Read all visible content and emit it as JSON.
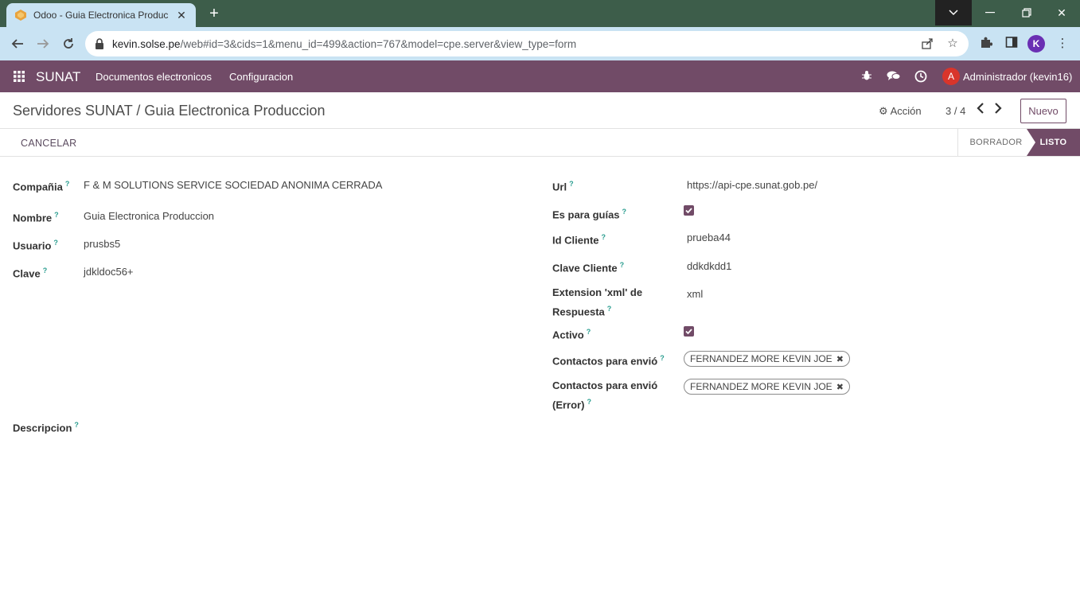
{
  "browser": {
    "tab_title": "Odoo - Guia Electronica Produc",
    "url_host": "kevin.solse.pe",
    "url_path": "/web#id=3&cids=1&menu_id=499&action=767&model=cpe.server&view_type=form",
    "profile_initial": "K"
  },
  "navbar": {
    "brand": "SUNAT",
    "menu": [
      "Documentos electronicos",
      "Configuracion"
    ],
    "user_initial": "A",
    "user_name": "Administrador (kevin16)"
  },
  "control": {
    "breadcrumb": "Servidores SUNAT / Guia Electronica Produccion",
    "action_label": "Acción",
    "pager": "3 / 4",
    "new_label": "Nuevo"
  },
  "statusbar": {
    "cancel_label": "CANCELAR",
    "stages": [
      "BORRADOR",
      "LISTO"
    ],
    "active_stage": "LISTO"
  },
  "form": {
    "left": [
      {
        "label": "Compañia",
        "value": "F & M SOLUTIONS SERVICE SOCIEDAD ANONIMA CERRADA"
      },
      {
        "label": "Nombre",
        "value": "Guia Electronica Produccion"
      },
      {
        "label": "Usuario",
        "value": "prusbs5"
      },
      {
        "label": "Clave",
        "value": "jdkldoc56+"
      }
    ],
    "description_label": "Descripcion",
    "right": {
      "url_label": "Url",
      "url_value": "https://api-cpe.sunat.gob.pe/",
      "es_para_guias_label": "Es para guías",
      "es_para_guias_checked": true,
      "id_cliente_label": "Id Cliente",
      "id_cliente_value": "prueba44",
      "clave_cliente_label": "Clave Cliente",
      "clave_cliente_value": "ddkdkdd1",
      "extension_label_line1": "Extension 'xml' de",
      "extension_label_line2": "Respuesta",
      "extension_value": "xml",
      "activo_label": "Activo",
      "activo_checked": true,
      "contactos_label": "Contactos para envió",
      "contactos_tag": "FERNANDEZ MORE KEVIN JOE",
      "contactos_error_label_line1": "Contactos para envió",
      "contactos_error_label_line2": "(Error)",
      "contactos_error_tag": "FERNANDEZ MORE KEVIN JOE"
    },
    "help_mark": "?"
  },
  "colors": {
    "primary": "#714b67",
    "browser_frame": "#3d5d4a",
    "browser_toolbar": "#c9e3f3",
    "help": "#2a9d8f"
  }
}
